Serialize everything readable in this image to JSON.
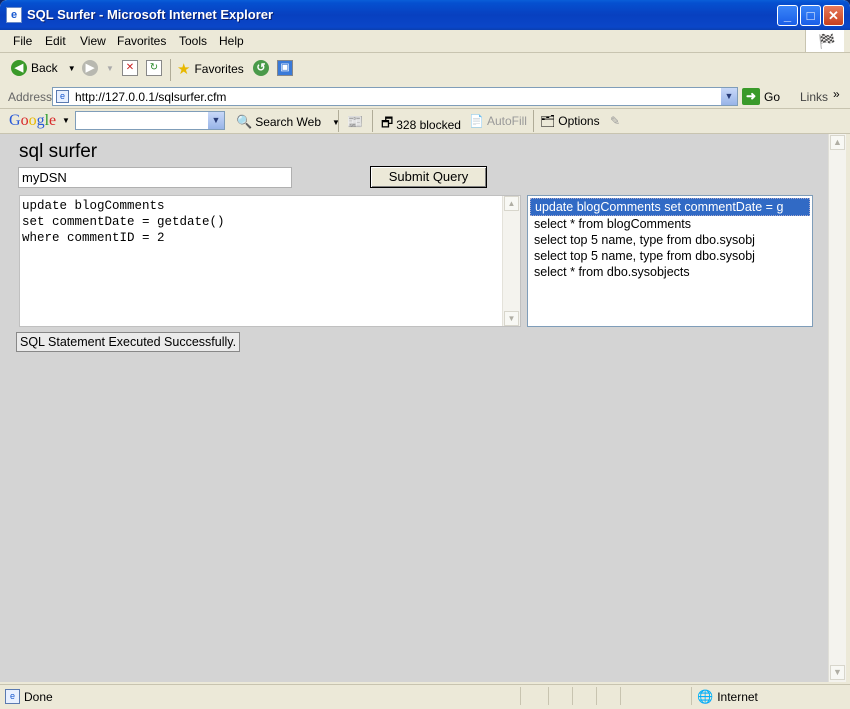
{
  "window": {
    "title": "SQL Surfer - Microsoft Internet Explorer",
    "minimize": "_",
    "maximize": "□",
    "close": "✕"
  },
  "menu": [
    "File",
    "Edit",
    "View",
    "Favorites",
    "Tools",
    "Help"
  ],
  "toolbar": {
    "back": "Back",
    "favorites": "Favorites"
  },
  "address": {
    "label": "Address",
    "url": "http://127.0.0.1/sqlsurfer.cfm",
    "go": "Go",
    "links": "Links"
  },
  "google": {
    "logo": "Google",
    "search_web": "Search Web",
    "blocked": "328 blocked",
    "autofill": "AutoFill",
    "options": "Options"
  },
  "page": {
    "title": "sql surfer",
    "dsn_value": "myDSN",
    "submit_label": "Submit Query",
    "sql_text": "update blogComments\nset commentDate = getdate()\nwhere commentID = 2",
    "history": [
      "update blogComments set commentDate = g",
      "select * from blogComments",
      "select top 5 name, type from dbo.sysobj",
      "select top 5 name, type from dbo.sysobj",
      "select * from dbo.sysobjects"
    ],
    "history_selected": 0,
    "result_message": "SQL Statement Executed Successfully."
  },
  "status": {
    "text": "Done",
    "zone": "Internet"
  },
  "colors": {
    "titlebar": "#0840c0",
    "page_bg": "#d4d4d4",
    "selection": "#316ac5"
  }
}
